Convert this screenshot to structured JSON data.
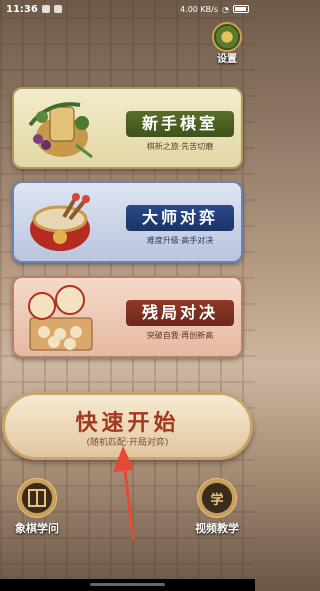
{
  "status_bar": {
    "time": "11:36",
    "right_text": "4.00 KB/s"
  },
  "settings": {
    "label": "设置"
  },
  "modes": [
    {
      "title": "新手棋室",
      "subtitle": "棋新之旅·先苦切磨"
    },
    {
      "title": "大师对弈",
      "subtitle": "难度升级·高手对决"
    },
    {
      "title": "残局对决",
      "subtitle": "突破自我·再创新高"
    }
  ],
  "quick_match": {
    "title": "快速开始",
    "subtitle": "(随机匹配·开局对弈)"
  },
  "bottom": {
    "left_label": "象棋学问",
    "right_label": "视频教学",
    "right_icon_char": "学"
  },
  "colors": {
    "accent_red": "#a2381e",
    "annotation_arrow": "#e8483a"
  }
}
